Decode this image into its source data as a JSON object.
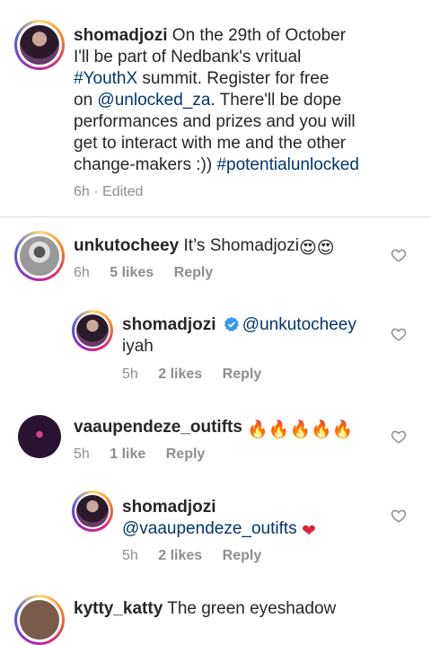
{
  "caption": {
    "username": "shomadjozi",
    "line1_rest": " On the 29th of October",
    "line2": "I'll be part of Nedbank's vritual",
    "line3_tag": "#YouthX",
    "line3_rest": " summit. Register for free",
    "line4_pre": "on ",
    "line4_mention": "@unlocked_za",
    "line4_rest": ". There'll be dope",
    "line5": "performances and prizes and you will",
    "line6": "get to interact with me and the other",
    "line7_pre": "change-makers :)) ",
    "line7_tag": "#potentialunlocked",
    "time": "6h",
    "sep": "·",
    "edited": "Edited"
  },
  "comments": [
    {
      "username": "unkutocheey",
      "text": " It’s Shomadjozi",
      "time": "6h",
      "likes": "5 likes",
      "reply": "Reply"
    },
    {
      "username": "shomadjozi",
      "mention": "@unkutocheey",
      "text": "iyah",
      "time": "5h",
      "likes": "2 likes",
      "reply": "Reply",
      "verified": true
    },
    {
      "username": "vaaupendeze_outifts",
      "time": "5h",
      "likes": "1 like",
      "reply": "Reply"
    },
    {
      "username": "shomadjozi",
      "mention": "@vaaupendeze_outifts",
      "time": "5h",
      "likes": "2 likes",
      "reply": "Reply"
    },
    {
      "username": "kytty_katty",
      "text": " The green eyeshadow"
    }
  ],
  "colors": {
    "link": "#00376b",
    "verified": "#3897f0",
    "meta": "#8e8e8e",
    "heart_red": "#e0203a"
  },
  "icons": [
    "heart-outline-icon",
    "verified-badge-icon",
    "fire-emoji",
    "heart-eyes-emoji",
    "red-heart-emoji"
  ]
}
